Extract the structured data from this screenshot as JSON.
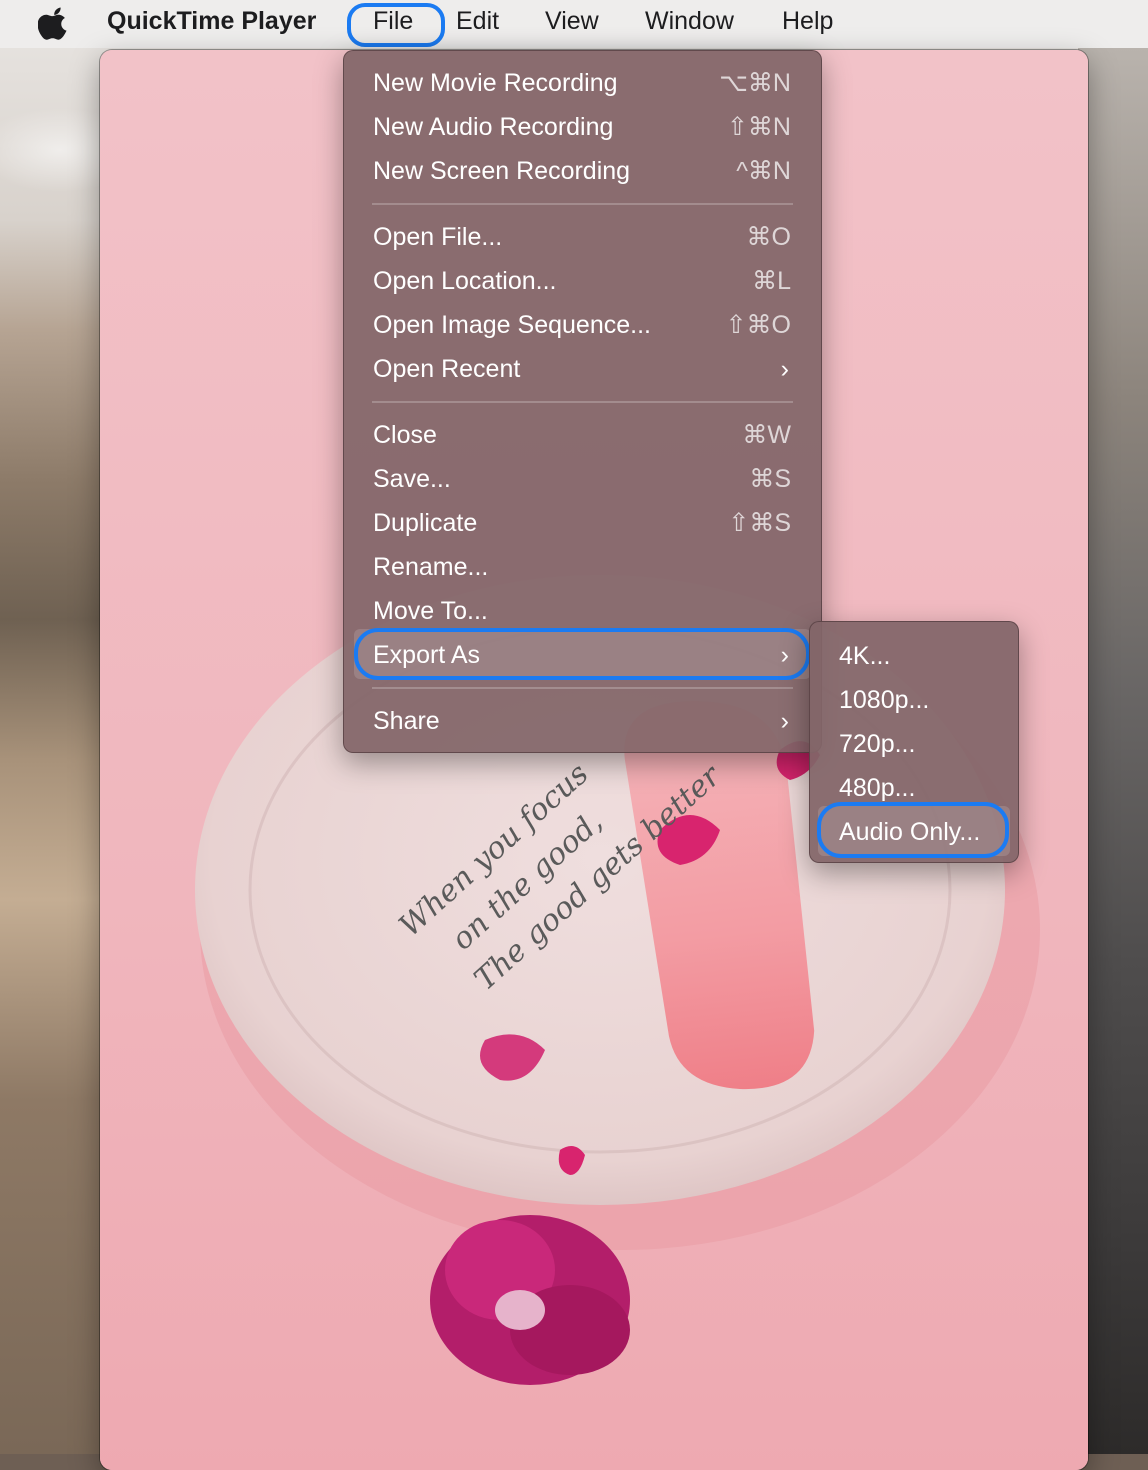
{
  "menubar": {
    "app_name": "QuickTime Player",
    "items": [
      "File",
      "Edit",
      "View",
      "Window",
      "Help"
    ]
  },
  "file_menu": {
    "items": [
      {
        "label": "New Movie Recording",
        "shortcut": "⌥⌘N"
      },
      {
        "label": "New Audio Recording",
        "shortcut": "⇧⌘N"
      },
      {
        "label": "New Screen Recording",
        "shortcut": "^⌘N"
      },
      {
        "label": "Open File...",
        "shortcut": "⌘O"
      },
      {
        "label": "Open Location...",
        "shortcut": "⌘L"
      },
      {
        "label": "Open Image Sequence...",
        "shortcut": "⇧⌘O"
      },
      {
        "label": "Open Recent",
        "shortcut": ""
      },
      {
        "label": "Close",
        "shortcut": "⌘W"
      },
      {
        "label": "Save...",
        "shortcut": "⌘S"
      },
      {
        "label": "Duplicate",
        "shortcut": "⇧⌘S"
      },
      {
        "label": "Rename...",
        "shortcut": ""
      },
      {
        "label": "Move To...",
        "shortcut": ""
      },
      {
        "label": "Export As",
        "shortcut": ""
      },
      {
        "label": "Share",
        "shortcut": ""
      }
    ]
  },
  "export_submenu": {
    "items": [
      "4K...",
      "1080p...",
      "720p...",
      "480p...",
      "Audio Only..."
    ]
  },
  "video_frame": {
    "handwriting": [
      "When you focus",
      "on the good,",
      "The good gets better"
    ]
  },
  "colors": {
    "highlight_ring": "#1b7bf2",
    "menu_bg": "#826568",
    "menubar_bg": "#eeedec"
  }
}
